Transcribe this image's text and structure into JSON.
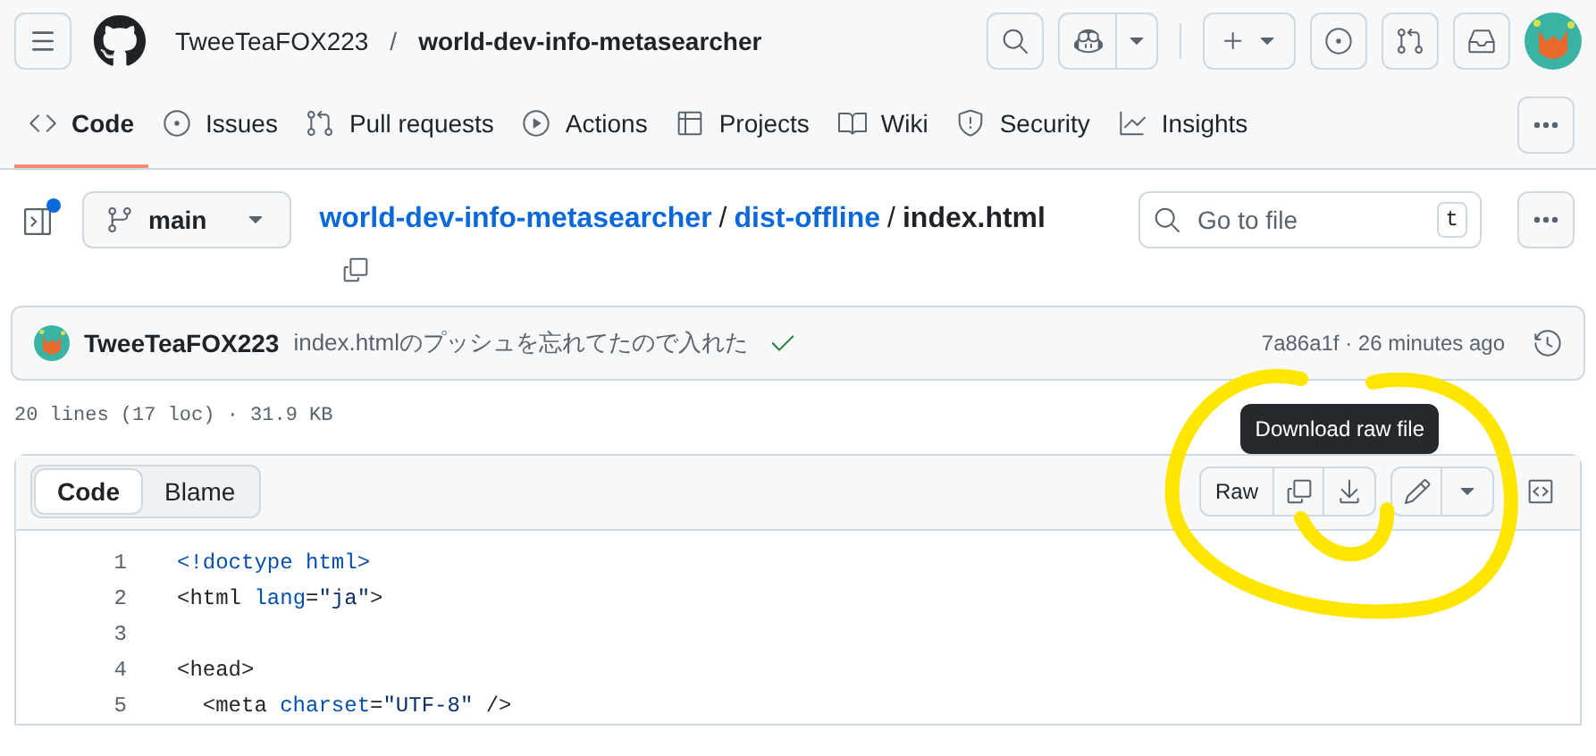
{
  "repo": {
    "owner": "TweeTeaFOX223",
    "separator": "/",
    "name": "world-dev-info-metasearcher"
  },
  "tabs": [
    {
      "label": "Code",
      "kind": "code",
      "selected": true
    },
    {
      "label": "Issues",
      "kind": "issues",
      "selected": false
    },
    {
      "label": "Pull requests",
      "kind": "pulls",
      "selected": false
    },
    {
      "label": "Actions",
      "kind": "actions",
      "selected": false
    },
    {
      "label": "Projects",
      "kind": "projects",
      "selected": false
    },
    {
      "label": "Wiki",
      "kind": "wiki",
      "selected": false
    },
    {
      "label": "Security",
      "kind": "security",
      "selected": false
    },
    {
      "label": "Insights",
      "kind": "insights",
      "selected": false
    }
  ],
  "branch": "main",
  "breadcrumb": [
    {
      "label": "world-dev-info-metasearcher",
      "kind": "link"
    },
    {
      "label": "dist-offline",
      "kind": "link"
    },
    {
      "label": "index.html",
      "kind": "current"
    }
  ],
  "breadcrumb_separator": "/",
  "file_search": {
    "placeholder": "Go to file",
    "shortcut": "t"
  },
  "commit": {
    "author": "TweeTeaFOX223",
    "message": "index.htmlのプッシュを忘れてたので入れた",
    "checks_passed": true,
    "meta": "7a86a1f · 26 minutes ago"
  },
  "file_info": "20 lines (17 loc) · 31.9 KB",
  "view_tabs": [
    {
      "label": "Code",
      "selected": true
    },
    {
      "label": "Blame",
      "selected": false
    }
  ],
  "raw_button": "Raw",
  "tooltip": "Download raw file",
  "code_lines": [
    {
      "number": "1",
      "tokens": [
        {
          "text": "<!doctype html>",
          "kind": "doctype"
        }
      ]
    },
    {
      "number": "2",
      "tokens": [
        {
          "text": "<html ",
          "kind": "plain"
        },
        {
          "text": "lang",
          "kind": "attr"
        },
        {
          "text": "=",
          "kind": "plain"
        },
        {
          "text": "\"ja\"",
          "kind": "string"
        },
        {
          "text": ">",
          "kind": "plain"
        }
      ]
    },
    {
      "number": "3"
    },
    {
      "number": "4",
      "tokens": [
        {
          "text": "<head>",
          "kind": "plain"
        }
      ]
    },
    {
      "number": "5",
      "tokens": [
        {
          "text": "  <meta ",
          "kind": "plain"
        },
        {
          "text": "charset",
          "kind": "attr"
        },
        {
          "text": "=",
          "kind": "plain"
        },
        {
          "text": "\"UTF-8\"",
          "kind": "string"
        },
        {
          "text": " />",
          "kind": "plain"
        }
      ]
    }
  ]
}
